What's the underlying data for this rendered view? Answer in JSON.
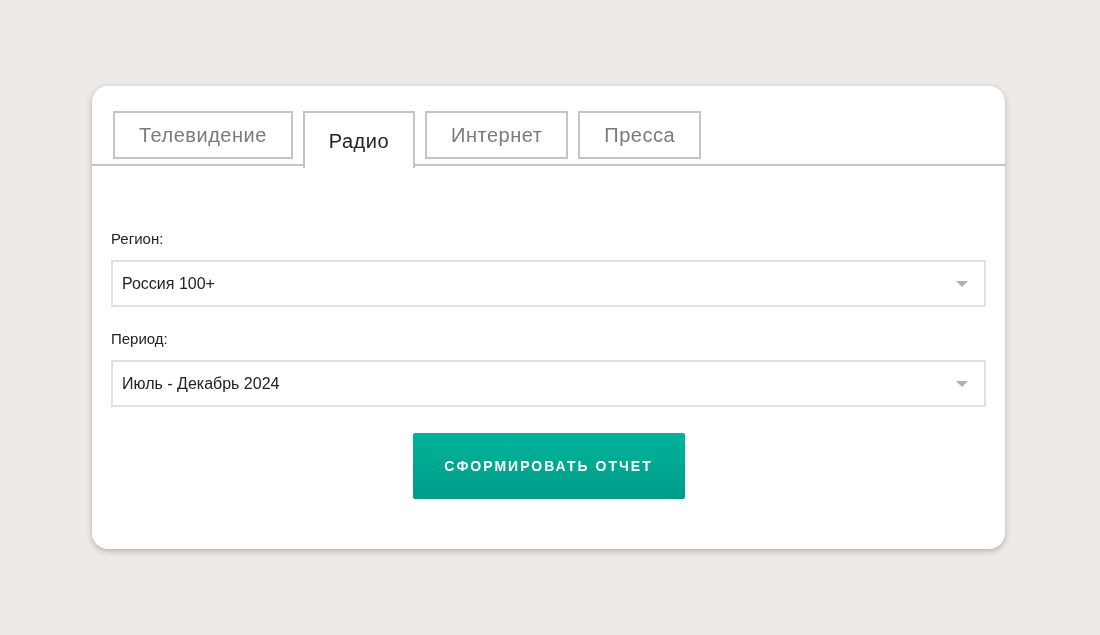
{
  "tabs": [
    {
      "label": "Телевидение",
      "selected": false
    },
    {
      "label": "Радио",
      "selected": true
    },
    {
      "label": "Интернет",
      "selected": false
    },
    {
      "label": "Пресса",
      "selected": false
    }
  ],
  "fields": [
    {
      "label": "Регион:",
      "value": "Россия 100+"
    },
    {
      "label": "Период:",
      "value": "Июль - Декабрь 2024"
    }
  ],
  "submit_button": "СФОРМИРОВАТЬ ОТЧЕТ"
}
